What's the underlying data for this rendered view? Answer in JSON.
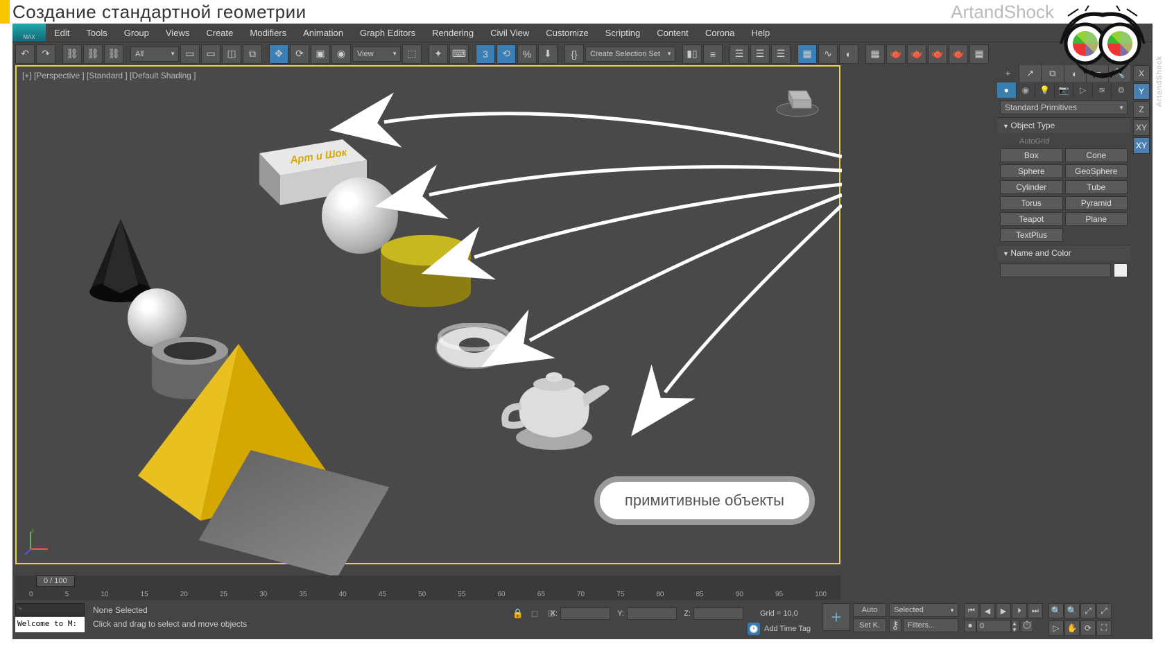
{
  "header": {
    "title": "Создание стандартной геометрии",
    "brand": "ArtandShock",
    "side_watermark": "ArtandShock"
  },
  "menubar": {
    "logo": "MAX",
    "items": [
      "Edit",
      "Tools",
      "Group",
      "Views",
      "Create",
      "Modifiers",
      "Animation",
      "Graph Editors",
      "Rendering",
      "Civil View",
      "Customize",
      "Scripting",
      "Content",
      "Corona",
      "Help"
    ]
  },
  "toolbar": {
    "all_filter": "All",
    "view_mode": "View",
    "selection_set": "Create Selection Set"
  },
  "viewport": {
    "label": "[+] [Perspective ] [Standard ] [Default Shading ]",
    "box_text": "Арт и Шок",
    "callout": "примитивные объекты"
  },
  "side_tabs": {
    "items": [
      "X",
      "Y",
      "Z",
      "XY",
      "XY"
    ],
    "active_index": 1
  },
  "command_panel": {
    "dropdown": "Standard Primitives",
    "rollout_object_type": "Object Type",
    "autogrid": "AutoGrid",
    "buttons": [
      [
        "Box",
        "Cone"
      ],
      [
        "Sphere",
        "GeoSphere"
      ],
      [
        "Cylinder",
        "Tube"
      ],
      [
        "Torus",
        "Pyramid"
      ],
      [
        "Teapot",
        "Plane"
      ]
    ],
    "textplus": "TextPlus",
    "rollout_name_color": "Name and Color"
  },
  "timeline": {
    "frame_label": "0 / 100",
    "ticks": [
      "0",
      "5",
      "10",
      "15",
      "20",
      "25",
      "30",
      "35",
      "40",
      "45",
      "50",
      "55",
      "60",
      "65",
      "70",
      "75",
      "80",
      "85",
      "90",
      "95",
      "100"
    ]
  },
  "status": {
    "welcome": "Welcome to M:",
    "none_selected": "None Selected",
    "prompt": "Click and drag to select and move objects",
    "coords": {
      "x": "X:",
      "y": "Y:",
      "z": "Z:",
      "grid": "Grid = 10,0"
    },
    "time_tag": "Add Time Tag"
  },
  "anim": {
    "auto": "Auto",
    "setk": "Set K.",
    "selected": "Selected",
    "filters": "Filters...",
    "frame": "0"
  }
}
